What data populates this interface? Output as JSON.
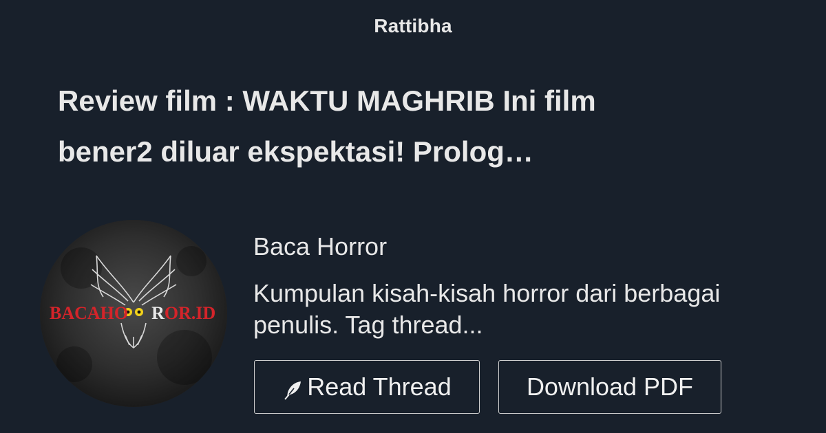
{
  "site": {
    "name": "Rattibha"
  },
  "thread": {
    "title_line1": "Review film : WAKTU MAGHRIB Ini film",
    "title_line2": "bener2 diluar ekspektasi! Prolog…"
  },
  "author": {
    "name": "Baca Horror",
    "bio_line1": "Kumpulan kisah-kisah horror dari berbagai",
    "bio_line2": "penulis. Tag thread...",
    "avatar_text_red1": "BACAHO",
    "avatar_text_white": "R",
    "avatar_text_red2": "OR",
    "avatar_text_suffix": ".ID"
  },
  "actions": {
    "read_label": "Read Thread",
    "read_icon": "feather-icon",
    "pdf_label": "Download PDF"
  },
  "colors": {
    "background": "#18202b",
    "text": "#e8e8e8",
    "logo_red": "#d4242a",
    "owl_eye": "#f2d21b"
  }
}
